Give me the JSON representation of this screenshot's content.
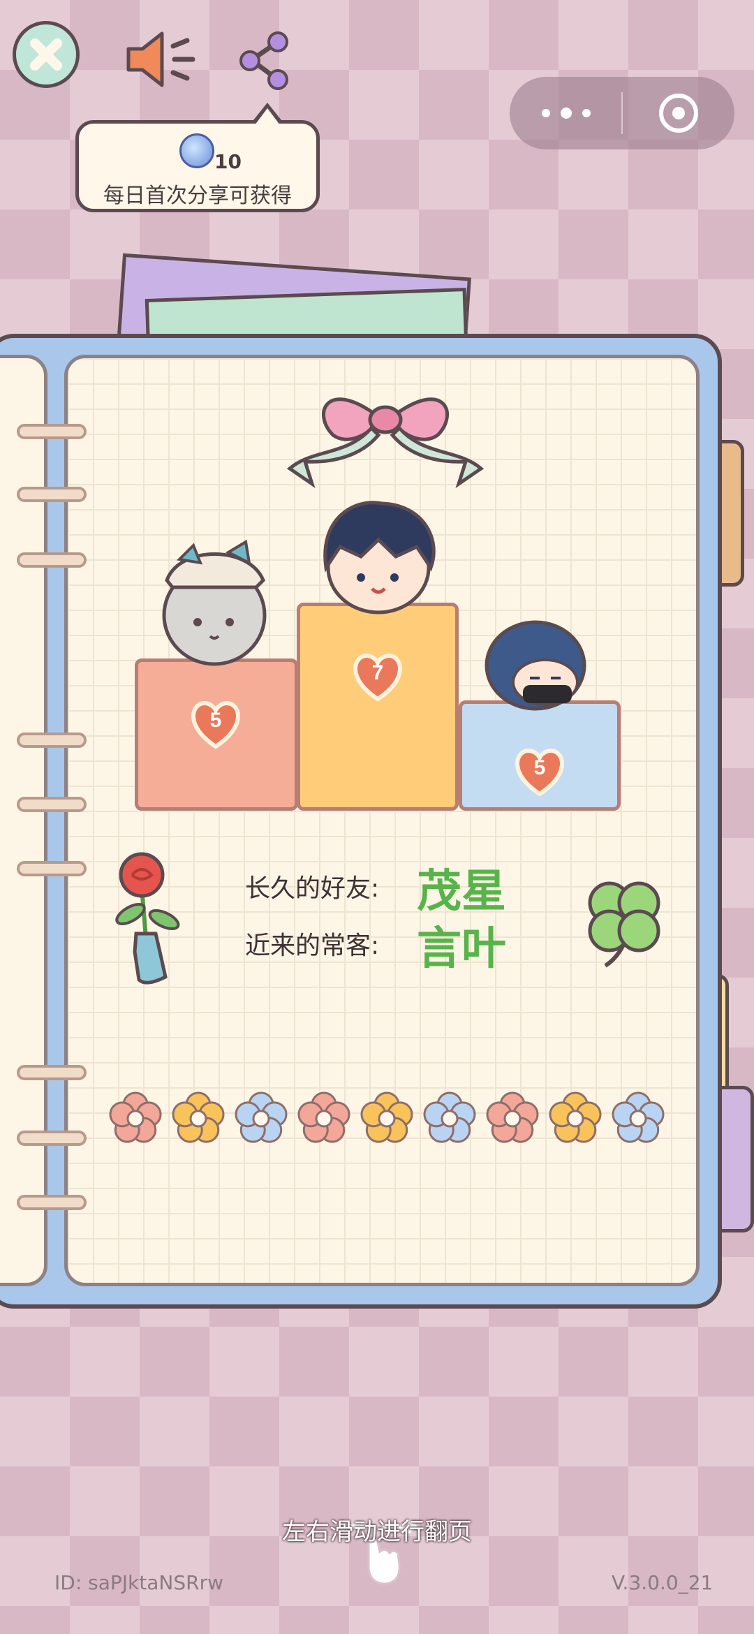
{
  "share_tip": {
    "count": "10",
    "text": "每日首次分享可获得"
  },
  "podium": [
    {
      "rank": "first",
      "value": "7",
      "color": "#ffcc7a"
    },
    {
      "rank": "second",
      "value": "5",
      "color": "#f6ad97"
    },
    {
      "rank": "third",
      "value": "5",
      "color": "#c3dcf2"
    }
  ],
  "friends": {
    "longtime_label": "长久的好友:",
    "longtime_name": "茂星",
    "recent_label": "近来的常客:",
    "recent_name": "言叶"
  },
  "flowers": [
    "pink",
    "yellow",
    "blue",
    "pink",
    "yellow",
    "blue",
    "pink",
    "yellow",
    "blue"
  ],
  "colors": {
    "accent_green": "#58b34a",
    "cover_blue": "#a9c7ea",
    "outline": "#5b4a4f"
  },
  "footer": {
    "hint": "左右滑动进行翻页",
    "id": "ID: saPJktaNSRrw",
    "version": "V.3.0.0_21"
  }
}
